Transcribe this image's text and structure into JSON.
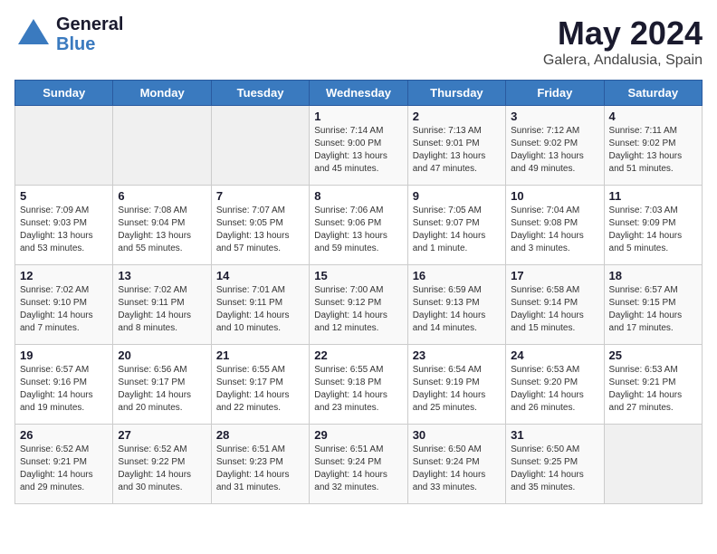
{
  "header": {
    "logo_line1": "General",
    "logo_line2": "Blue",
    "month_year": "May 2024",
    "location": "Galera, Andalusia, Spain"
  },
  "days_of_week": [
    "Sunday",
    "Monday",
    "Tuesday",
    "Wednesday",
    "Thursday",
    "Friday",
    "Saturday"
  ],
  "weeks": [
    [
      {
        "day": "",
        "empty": true
      },
      {
        "day": "",
        "empty": true
      },
      {
        "day": "",
        "empty": true
      },
      {
        "day": "1",
        "sunrise": "7:14 AM",
        "sunset": "9:00 PM",
        "daylight": "13 hours and 45 minutes."
      },
      {
        "day": "2",
        "sunrise": "7:13 AM",
        "sunset": "9:01 PM",
        "daylight": "13 hours and 47 minutes."
      },
      {
        "day": "3",
        "sunrise": "7:12 AM",
        "sunset": "9:02 PM",
        "daylight": "13 hours and 49 minutes."
      },
      {
        "day": "4",
        "sunrise": "7:11 AM",
        "sunset": "9:02 PM",
        "daylight": "13 hours and 51 minutes."
      }
    ],
    [
      {
        "day": "5",
        "sunrise": "7:09 AM",
        "sunset": "9:03 PM",
        "daylight": "13 hours and 53 minutes."
      },
      {
        "day": "6",
        "sunrise": "7:08 AM",
        "sunset": "9:04 PM",
        "daylight": "13 hours and 55 minutes."
      },
      {
        "day": "7",
        "sunrise": "7:07 AM",
        "sunset": "9:05 PM",
        "daylight": "13 hours and 57 minutes."
      },
      {
        "day": "8",
        "sunrise": "7:06 AM",
        "sunset": "9:06 PM",
        "daylight": "13 hours and 59 minutes."
      },
      {
        "day": "9",
        "sunrise": "7:05 AM",
        "sunset": "9:07 PM",
        "daylight": "14 hours and 1 minute."
      },
      {
        "day": "10",
        "sunrise": "7:04 AM",
        "sunset": "9:08 PM",
        "daylight": "14 hours and 3 minutes."
      },
      {
        "day": "11",
        "sunrise": "7:03 AM",
        "sunset": "9:09 PM",
        "daylight": "14 hours and 5 minutes."
      }
    ],
    [
      {
        "day": "12",
        "sunrise": "7:02 AM",
        "sunset": "9:10 PM",
        "daylight": "14 hours and 7 minutes."
      },
      {
        "day": "13",
        "sunrise": "7:02 AM",
        "sunset": "9:11 PM",
        "daylight": "14 hours and 8 minutes."
      },
      {
        "day": "14",
        "sunrise": "7:01 AM",
        "sunset": "9:11 PM",
        "daylight": "14 hours and 10 minutes."
      },
      {
        "day": "15",
        "sunrise": "7:00 AM",
        "sunset": "9:12 PM",
        "daylight": "14 hours and 12 minutes."
      },
      {
        "day": "16",
        "sunrise": "6:59 AM",
        "sunset": "9:13 PM",
        "daylight": "14 hours and 14 minutes."
      },
      {
        "day": "17",
        "sunrise": "6:58 AM",
        "sunset": "9:14 PM",
        "daylight": "14 hours and 15 minutes."
      },
      {
        "day": "18",
        "sunrise": "6:57 AM",
        "sunset": "9:15 PM",
        "daylight": "14 hours and 17 minutes."
      }
    ],
    [
      {
        "day": "19",
        "sunrise": "6:57 AM",
        "sunset": "9:16 PM",
        "daylight": "14 hours and 19 minutes."
      },
      {
        "day": "20",
        "sunrise": "6:56 AM",
        "sunset": "9:17 PM",
        "daylight": "14 hours and 20 minutes."
      },
      {
        "day": "21",
        "sunrise": "6:55 AM",
        "sunset": "9:17 PM",
        "daylight": "14 hours and 22 minutes."
      },
      {
        "day": "22",
        "sunrise": "6:55 AM",
        "sunset": "9:18 PM",
        "daylight": "14 hours and 23 minutes."
      },
      {
        "day": "23",
        "sunrise": "6:54 AM",
        "sunset": "9:19 PM",
        "daylight": "14 hours and 25 minutes."
      },
      {
        "day": "24",
        "sunrise": "6:53 AM",
        "sunset": "9:20 PM",
        "daylight": "14 hours and 26 minutes."
      },
      {
        "day": "25",
        "sunrise": "6:53 AM",
        "sunset": "9:21 PM",
        "daylight": "14 hours and 27 minutes."
      }
    ],
    [
      {
        "day": "26",
        "sunrise": "6:52 AM",
        "sunset": "9:21 PM",
        "daylight": "14 hours and 29 minutes."
      },
      {
        "day": "27",
        "sunrise": "6:52 AM",
        "sunset": "9:22 PM",
        "daylight": "14 hours and 30 minutes."
      },
      {
        "day": "28",
        "sunrise": "6:51 AM",
        "sunset": "9:23 PM",
        "daylight": "14 hours and 31 minutes."
      },
      {
        "day": "29",
        "sunrise": "6:51 AM",
        "sunset": "9:24 PM",
        "daylight": "14 hours and 32 minutes."
      },
      {
        "day": "30",
        "sunrise": "6:50 AM",
        "sunset": "9:24 PM",
        "daylight": "14 hours and 33 minutes."
      },
      {
        "day": "31",
        "sunrise": "6:50 AM",
        "sunset": "9:25 PM",
        "daylight": "14 hours and 35 minutes."
      },
      {
        "day": "",
        "empty": true
      }
    ]
  ]
}
